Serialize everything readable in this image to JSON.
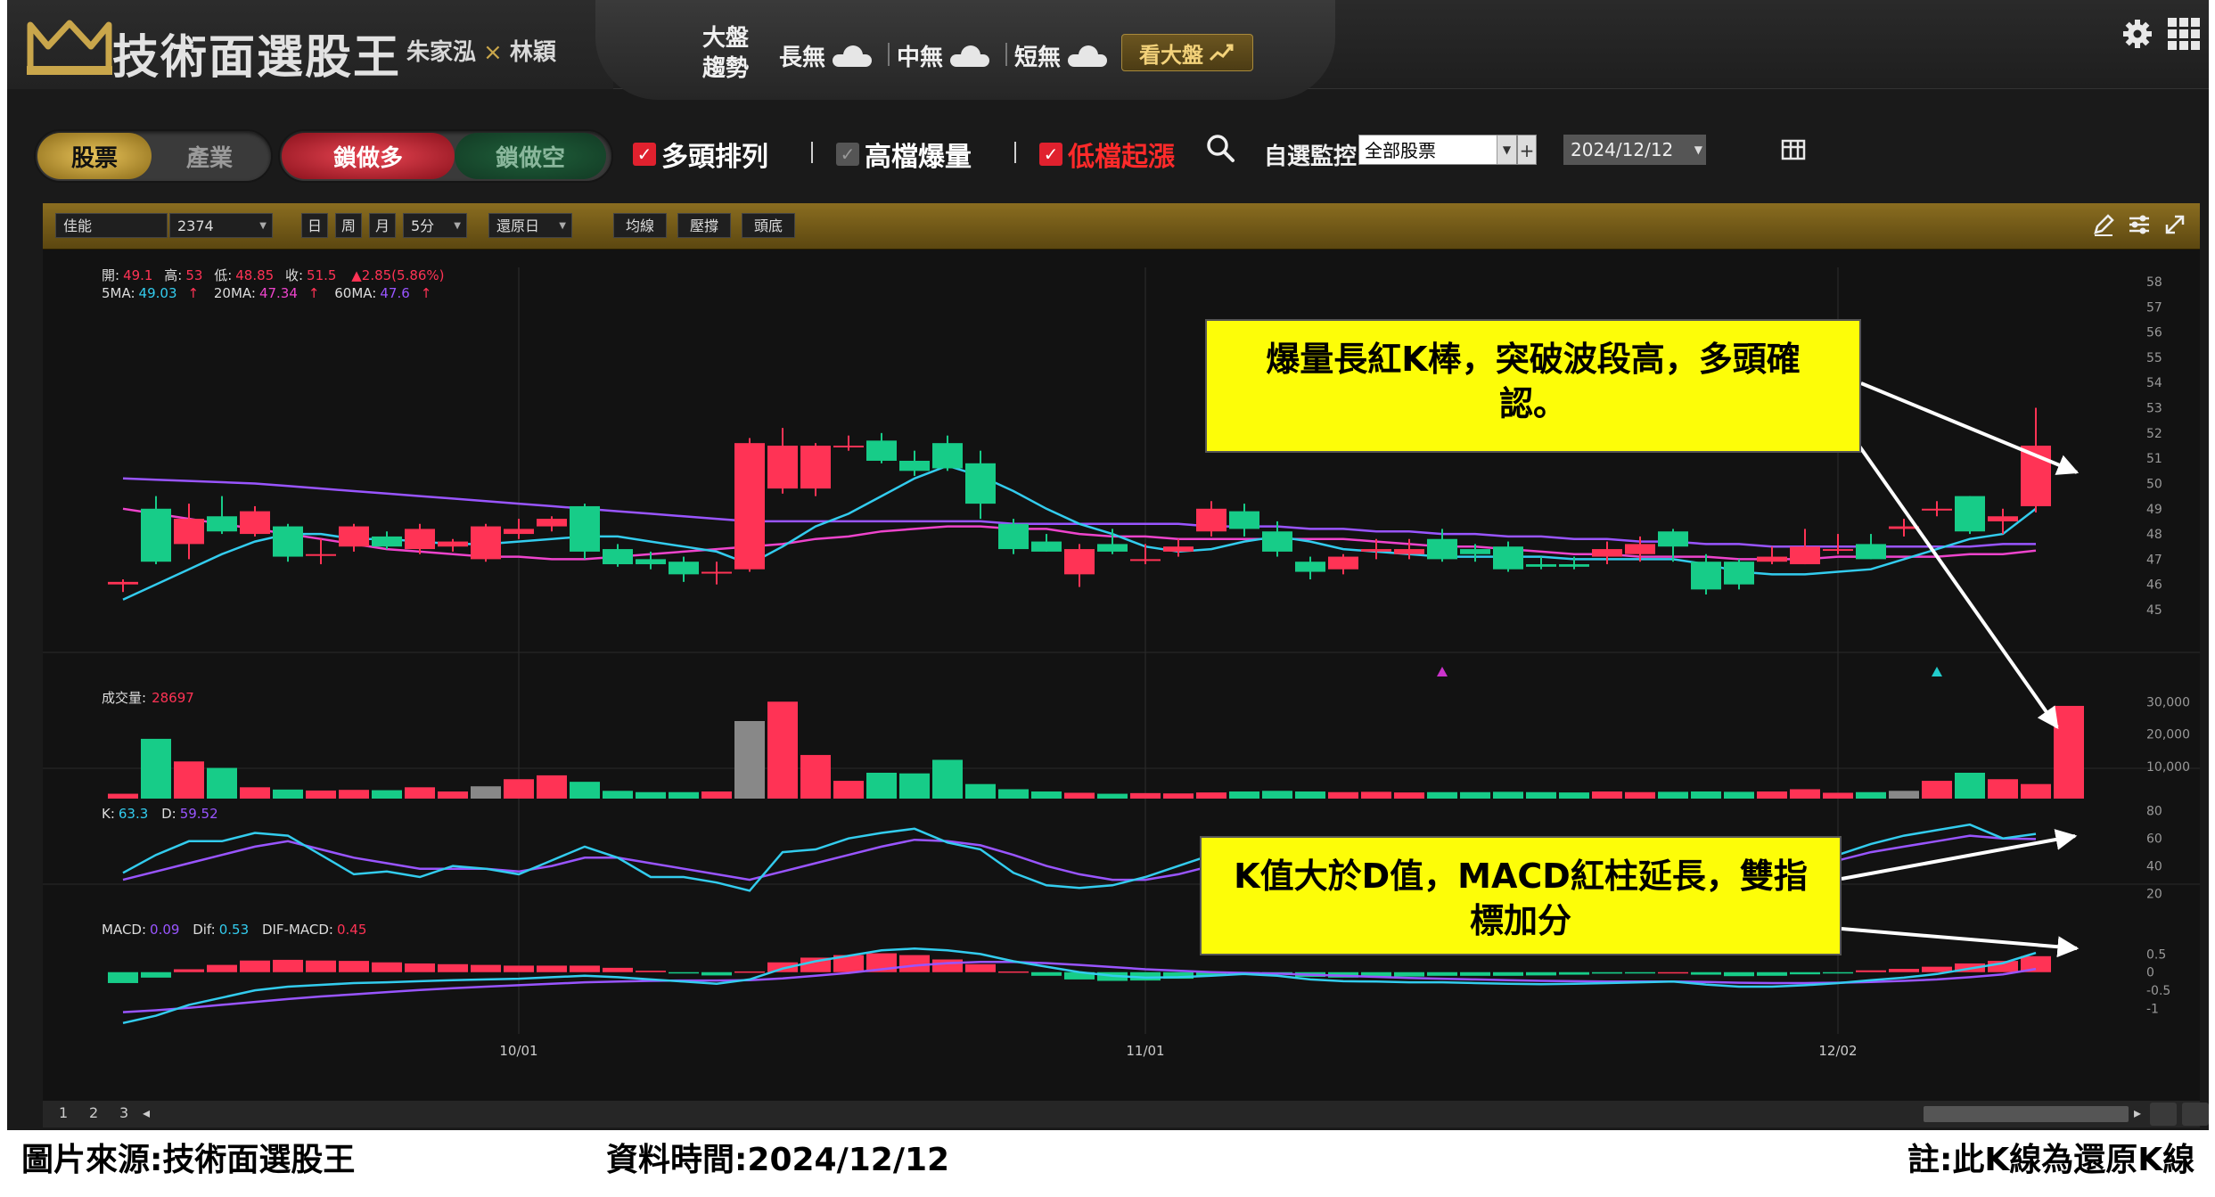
{
  "header": {
    "title": "技術面選股王",
    "author1": "朱家泓",
    "author_sep": "×",
    "author2": "林穎",
    "trend_label": "大盤趨勢",
    "trend_items": [
      {
        "label": "長無",
        "icon": "cloud-icon"
      },
      {
        "label": "中無",
        "icon": "cloud-icon"
      },
      {
        "label": "短無",
        "icon": "cloud-icon"
      }
    ],
    "market_button": "看大盤"
  },
  "toolbar": {
    "type_stock": "股票",
    "type_industry": "產業",
    "lock_long": "鎖做多",
    "lock_short": "鎖做空",
    "checks": [
      {
        "label": "多頭排列",
        "checked": true,
        "color": "#ffffff"
      },
      {
        "label": "高檔爆量",
        "checked": true,
        "color": "#ffffff"
      },
      {
        "label": "低檔起漲",
        "checked": true,
        "color": "#ff2a2a"
      }
    ],
    "watch_label": "自選監控",
    "watch_value": "全部股票",
    "date_value": "2024/12/12"
  },
  "chart_toolbar": {
    "stock_name": "佳能",
    "stock_code": "2374",
    "periods": [
      "日",
      "周",
      "月"
    ],
    "minute": "5分",
    "adjust": "還原日",
    "buttons": [
      "均線",
      "壓撐",
      "頭底"
    ]
  },
  "chart_data": {
    "type": "candlestick",
    "info": {
      "open_label": "開:",
      "open": "49.1",
      "high_label": "高:",
      "high": "53",
      "low_label": "低:",
      "low": "48.85",
      "close_label": "收:",
      "close": "51.5",
      "change": "▲2.85(5.86%)",
      "ma5_label": "5MA:",
      "ma5": "49.03",
      "ma20_label": "20MA:",
      "ma20": "47.34",
      "ma60_label": "60MA:",
      "ma60": "47.6",
      "up_arrow": "↑"
    },
    "price_ylim": [
      45,
      58
    ],
    "price_ticks": [
      45,
      46,
      47,
      48,
      49,
      50,
      51,
      52,
      53,
      54,
      55,
      56,
      57,
      58
    ],
    "candles": [
      [
        46.0,
        46.2,
        45.7,
        46.1
      ],
      [
        49.0,
        49.5,
        46.8,
        46.9
      ],
      [
        47.6,
        49.2,
        47.0,
        48.6
      ],
      [
        48.7,
        49.5,
        48.0,
        48.1
      ],
      [
        48.0,
        49.1,
        47.9,
        48.9
      ],
      [
        48.3,
        48.4,
        46.9,
        47.1
      ],
      [
        47.2,
        47.8,
        46.8,
        47.2
      ],
      [
        47.5,
        48.4,
        47.3,
        48.3
      ],
      [
        47.9,
        48.1,
        47.4,
        47.5
      ],
      [
        47.4,
        48.4,
        47.2,
        48.2
      ],
      [
        47.5,
        47.8,
        47.3,
        47.7
      ],
      [
        47.0,
        48.4,
        46.9,
        48.3
      ],
      [
        48.0,
        48.6,
        47.8,
        48.2
      ],
      [
        48.3,
        48.7,
        48.1,
        48.6
      ],
      [
        49.1,
        49.2,
        47.0,
        47.3
      ],
      [
        47.4,
        47.6,
        46.7,
        46.8
      ],
      [
        47.0,
        47.3,
        46.6,
        46.8
      ],
      [
        46.9,
        47.1,
        46.1,
        46.4
      ],
      [
        46.5,
        46.9,
        46.0,
        46.5
      ],
      [
        46.6,
        51.8,
        46.5,
        51.6
      ],
      [
        49.8,
        52.2,
        49.6,
        51.5
      ],
      [
        49.8,
        51.6,
        49.5,
        51.5
      ],
      [
        51.5,
        51.9,
        51.3,
        51.5
      ],
      [
        51.7,
        52.0,
        50.8,
        50.9
      ],
      [
        50.9,
        51.3,
        50.3,
        50.5
      ],
      [
        51.6,
        51.9,
        50.5,
        50.6
      ],
      [
        50.8,
        51.3,
        48.6,
        49.2
      ],
      [
        48.4,
        48.6,
        47.2,
        47.4
      ],
      [
        47.7,
        48.0,
        47.3,
        47.3
      ],
      [
        46.4,
        47.6,
        45.9,
        47.4
      ],
      [
        47.6,
        48.2,
        47.2,
        47.3
      ],
      [
        47.0,
        47.6,
        46.8,
        47.0
      ],
      [
        47.3,
        47.8,
        47.1,
        47.5
      ],
      [
        48.1,
        49.3,
        47.9,
        49.0
      ],
      [
        48.9,
        49.2,
        47.9,
        48.2
      ],
      [
        48.1,
        48.5,
        47.1,
        47.3
      ],
      [
        46.9,
        47.1,
        46.2,
        46.5
      ],
      [
        46.6,
        47.2,
        46.4,
        47.1
      ],
      [
        47.3,
        47.8,
        47.0,
        47.4
      ],
      [
        47.2,
        47.8,
        47.0,
        47.4
      ],
      [
        47.8,
        48.2,
        46.9,
        47.0
      ],
      [
        47.4,
        47.6,
        46.9,
        47.2
      ],
      [
        47.5,
        47.7,
        46.5,
        46.6
      ],
      [
        46.8,
        47.1,
        46.6,
        46.7
      ],
      [
        46.8,
        47.1,
        46.6,
        46.7
      ],
      [
        47.1,
        47.7,
        46.8,
        47.4
      ],
      [
        47.2,
        47.9,
        46.9,
        47.6
      ],
      [
        48.1,
        48.2,
        46.9,
        47.5
      ],
      [
        46.9,
        47.2,
        45.6,
        45.8
      ],
      [
        46.9,
        47.0,
        45.8,
        46.0
      ],
      [
        46.9,
        47.5,
        46.8,
        47.1
      ],
      [
        46.8,
        48.2,
        46.8,
        47.5
      ],
      [
        47.4,
        48.0,
        47.2,
        47.4
      ],
      [
        47.6,
        48.0,
        47.0,
        47.0
      ],
      [
        48.2,
        48.6,
        47.9,
        48.3
      ],
      [
        49.0,
        49.3,
        48.7,
        49.0
      ],
      [
        49.5,
        49.5,
        48.0,
        48.1
      ],
      [
        48.5,
        49.0,
        48.0,
        48.7
      ],
      [
        49.1,
        53.0,
        48.85,
        51.5
      ]
    ],
    "ma5": [
      45.4,
      46.0,
      46.6,
      47.2,
      47.7,
      48.0,
      48.0,
      47.8,
      47.8,
      47.7,
      47.6,
      47.6,
      47.7,
      47.8,
      47.9,
      47.9,
      47.7,
      47.5,
      47.3,
      46.8,
      47.5,
      48.3,
      48.8,
      49.5,
      50.2,
      50.7,
      50.3,
      49.7,
      49.0,
      48.4,
      48.0,
      47.5,
      47.3,
      47.4,
      47.7,
      47.9,
      47.7,
      47.4,
      47.3,
      47.2,
      47.1,
      47.1,
      47.1,
      47.1,
      47.0,
      47.0,
      47.0,
      47.0,
      46.8,
      46.5,
      46.4,
      46.4,
      46.5,
      46.6,
      47.0,
      47.4,
      47.8,
      48.0,
      49.0
    ],
    "ma20": [
      49.0,
      48.8,
      48.6,
      48.4,
      48.2,
      48.0,
      47.8,
      47.6,
      47.4,
      47.3,
      47.2,
      47.1,
      47.1,
      47.0,
      47.0,
      47.1,
      47.2,
      47.3,
      47.4,
      47.5,
      47.6,
      47.8,
      47.9,
      48.1,
      48.2,
      48.3,
      48.3,
      48.2,
      48.2,
      48.0,
      47.9,
      47.9,
      47.8,
      47.8,
      47.8,
      47.8,
      47.8,
      47.8,
      47.7,
      47.6,
      47.5,
      47.5,
      47.4,
      47.3,
      47.2,
      47.2,
      47.1,
      47.1,
      47.1,
      47.0,
      47.0,
      47.0,
      47.1,
      47.1,
      47.1,
      47.1,
      47.2,
      47.2,
      47.34
    ],
    "ma60": [
      50.2,
      50.15,
      50.1,
      50.05,
      50.0,
      49.9,
      49.8,
      49.7,
      49.6,
      49.5,
      49.4,
      49.3,
      49.2,
      49.1,
      49.0,
      48.9,
      48.8,
      48.7,
      48.6,
      48.5,
      48.5,
      48.5,
      48.5,
      48.5,
      48.5,
      48.5,
      48.5,
      48.4,
      48.4,
      48.4,
      48.4,
      48.4,
      48.4,
      48.3,
      48.3,
      48.3,
      48.2,
      48.2,
      48.1,
      48.1,
      48.0,
      48.0,
      47.9,
      47.9,
      47.8,
      47.8,
      47.7,
      47.7,
      47.6,
      47.6,
      47.5,
      47.5,
      47.5,
      47.5,
      47.5,
      47.5,
      47.5,
      47.6,
      47.6
    ],
    "markers": [
      {
        "index": 40,
        "color": "#cc33cc"
      },
      {
        "index": 55,
        "color": "#22cccc"
      }
    ],
    "volume_label": "成交量:",
    "volume_value": "28697",
    "volume_ylim": [
      0,
      32000
    ],
    "volume_ticks": [
      "10,000",
      "20,000",
      "30,000"
    ],
    "volume_tick_values": [
      10000,
      20000,
      30000
    ],
    "volume": [
      1500,
      18500,
      11500,
      9500,
      3500,
      2800,
      2500,
      2700,
      2600,
      3500,
      2200,
      3800,
      6000,
      7200,
      5200,
      2400,
      2000,
      2000,
      2200,
      24000,
      30000,
      13500,
      5500,
      8000,
      7800,
      12000,
      4500,
      2900,
      2200,
      1800,
      1500,
      1700,
      1600,
      1900,
      2200,
      2400,
      2200,
      2000,
      2100,
      1900,
      2000,
      2000,
      2100,
      2000,
      1900,
      2200,
      2000,
      2100,
      2200,
      2100,
      2200,
      2900,
      1800,
      2000,
      2400,
      5500,
      8000,
      6000,
      4500,
      28697
    ],
    "volume_gray": [
      11,
      19,
      54
    ],
    "kd_label_k": "K:",
    "kd_k": "63.3",
    "kd_label_d": "D:",
    "kd_d": "59.52",
    "kd_ylim": [
      10,
      85
    ],
    "kd_ticks": [
      20,
      40,
      60,
      80
    ],
    "k_values": [
      35,
      48,
      58,
      58,
      64,
      62,
      48,
      34,
      36,
      32,
      40,
      38,
      34,
      44,
      54,
      46,
      32,
      32,
      28,
      22,
      50,
      52,
      60,
      64,
      67,
      57,
      52,
      35,
      26,
      24,
      26,
      32,
      40,
      48,
      52,
      46,
      40,
      35,
      30,
      32,
      34,
      30,
      30,
      32,
      36,
      40,
      45,
      52,
      54,
      48,
      40,
      40,
      48,
      56,
      62,
      66,
      70,
      60,
      63.3
    ],
    "d_values": [
      30,
      36,
      42,
      48,
      54,
      58,
      52,
      46,
      42,
      38,
      38,
      38,
      36,
      40,
      46,
      46,
      42,
      38,
      34,
      30,
      36,
      42,
      48,
      54,
      59,
      58,
      55,
      48,
      40,
      34,
      30,
      30,
      34,
      40,
      44,
      46,
      44,
      40,
      36,
      34,
      34,
      32,
      31,
      31,
      33,
      36,
      40,
      44,
      48,
      48,
      44,
      42,
      44,
      50,
      54,
      58,
      62,
      60,
      59.52
    ],
    "macd_label": "MACD:",
    "macd_value": "0.09",
    "dif_label": "Dif:",
    "dif_value": "0.53",
    "osc_label": "DIF-MACD:",
    "osc_value": "0.45",
    "macd_ylim": [
      -1.7,
      1.0
    ],
    "macd_ticks": [
      "-1",
      "-0.5",
      "0",
      "0.5"
    ],
    "macd_tick_values": [
      -1,
      -0.5,
      0,
      0.5
    ],
    "dif_values": [
      -1.4,
      -1.2,
      -0.9,
      -0.7,
      -0.5,
      -0.4,
      -0.35,
      -0.3,
      -0.28,
      -0.25,
      -0.22,
      -0.2,
      -0.18,
      -0.14,
      -0.1,
      -0.14,
      -0.2,
      -0.26,
      -0.32,
      -0.2,
      0.1,
      0.3,
      0.45,
      0.6,
      0.65,
      0.6,
      0.5,
      0.3,
      0.15,
      0.0,
      -0.1,
      -0.15,
      -0.14,
      -0.1,
      -0.05,
      -0.1,
      -0.2,
      -0.25,
      -0.26,
      -0.28,
      -0.28,
      -0.3,
      -0.32,
      -0.33,
      -0.32,
      -0.3,
      -0.28,
      -0.26,
      -0.34,
      -0.4,
      -0.4,
      -0.36,
      -0.3,
      -0.22,
      -0.15,
      -0.05,
      0.1,
      0.25,
      0.53
    ],
    "macd_values": [
      -1.1,
      -1.05,
      -0.98,
      -0.9,
      -0.82,
      -0.74,
      -0.67,
      -0.61,
      -0.55,
      -0.49,
      -0.44,
      -0.4,
      -0.36,
      -0.32,
      -0.28,
      -0.26,
      -0.24,
      -0.23,
      -0.23,
      -0.22,
      -0.17,
      -0.1,
      -0.02,
      0.08,
      0.18,
      0.25,
      0.28,
      0.28,
      0.25,
      0.2,
      0.14,
      0.08,
      0.04,
      0.0,
      -0.02,
      -0.04,
      -0.07,
      -0.1,
      -0.13,
      -0.16,
      -0.18,
      -0.2,
      -0.22,
      -0.24,
      -0.25,
      -0.26,
      -0.26,
      -0.26,
      -0.27,
      -0.29,
      -0.3,
      -0.3,
      -0.29,
      -0.27,
      -0.24,
      -0.2,
      -0.14,
      -0.06,
      0.09
    ],
    "x_labels": [
      {
        "index": 12,
        "label": "10/01"
      },
      {
        "index": 31,
        "label": "11/01"
      },
      {
        "index": 52,
        "label": "12/02"
      }
    ]
  },
  "annotations": {
    "top": "爆量長紅K棒，突破波段高，多頭確認。",
    "bottom": "K值大於D值，MACD紅柱延長，雙指標加分"
  },
  "pager": {
    "pages": [
      "1",
      "2",
      "3"
    ]
  },
  "caption": {
    "source": "圖片來源:技術面選股王",
    "time": "資料時間:2024/12/12",
    "note": "註:此K線為還原K線"
  },
  "colors": {
    "up": "#ff3355",
    "down": "#17cc88",
    "ma5": "#33ccee",
    "ma20": "#ee44cc",
    "ma60": "#9955ff",
    "gold": "#c9a64b"
  }
}
